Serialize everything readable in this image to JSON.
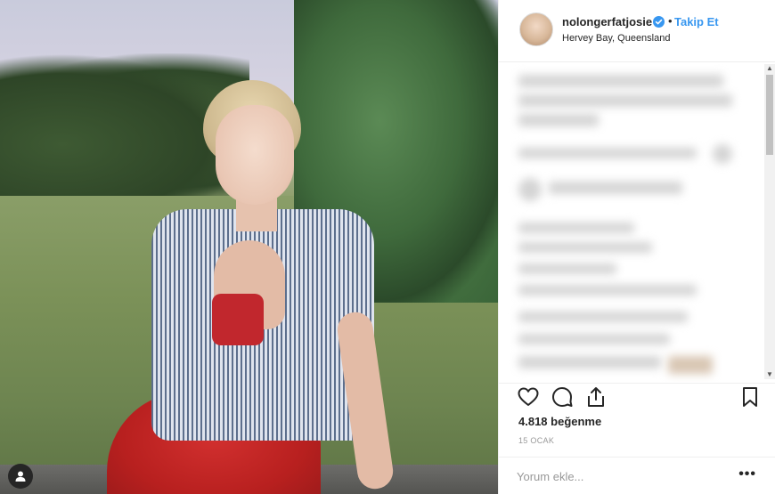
{
  "post": {
    "username": "nolongerfatjosie",
    "separator": "•",
    "follow_label": "Takip Et",
    "location": "Hervey Bay, Queensland",
    "likes_text": "4.818 beğenme",
    "date_text": "15 OCAK",
    "comment_placeholder": "Yorum ekle...",
    "more_label": "•••"
  },
  "icons": {
    "like": "heart-icon",
    "comment": "comment-bubble-icon",
    "share": "share-icon",
    "save": "bookmark-icon",
    "verified": "verified-badge-icon",
    "tag": "user-tag-icon"
  },
  "colors": {
    "link": "#3897f0",
    "verified": "#3897f0",
    "text": "#262626",
    "muted": "#999999",
    "border": "#efefef"
  }
}
